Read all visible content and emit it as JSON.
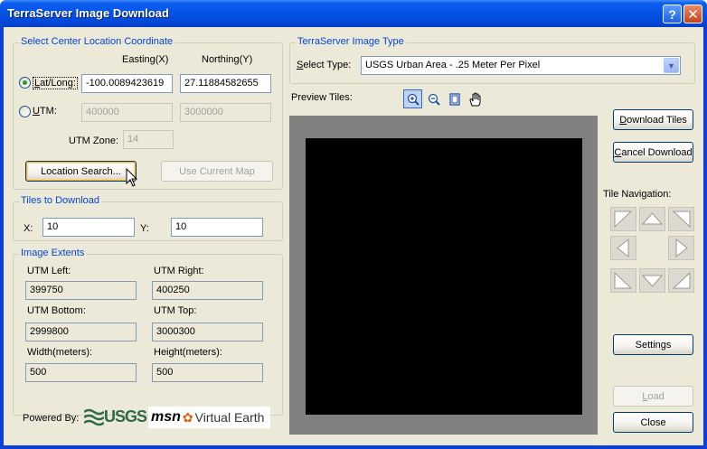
{
  "window": {
    "title": "TerraServer Image Download",
    "help_glyph": "?",
    "close_glyph": "✕"
  },
  "center": {
    "group_title": "Select Center Location Coordinate",
    "easting_header": "Easting(X)",
    "northing_header": "Northing(Y)",
    "latlong_label": "Lat/Long:",
    "latlong_selected": true,
    "latlong_easting": "-100.0089423619",
    "latlong_northing": "27.11884582655",
    "utm_label": "UTM:",
    "utm_easting": "400000",
    "utm_northing": "3000000",
    "utm_zone_label": "UTM Zone:",
    "utm_zone": "14",
    "location_search_label": "Location Search...",
    "use_current_map_label": "Use Current Map"
  },
  "tiles": {
    "group_title": "Tiles to Download",
    "x_label": "X:",
    "x_value": "10",
    "y_label": "Y:",
    "y_value": "10"
  },
  "extents": {
    "group_title": "Image Extents",
    "utm_left_label": "UTM Left:",
    "utm_left": "399750",
    "utm_right_label": "UTM Right:",
    "utm_right": "400250",
    "utm_bottom_label": "UTM Bottom:",
    "utm_bottom": "2999800",
    "utm_top_label": "UTM Top:",
    "utm_top": "3000300",
    "width_label": "Width(meters):",
    "width": "500",
    "height_label": "Height(meters):",
    "height": "500"
  },
  "footer": {
    "powered_by": "Powered By:",
    "usgs_logo": "USGS",
    "msn_logo": "msn",
    "virtual_earth_logo": "Virtual Earth"
  },
  "image_type": {
    "group_title": "TerraServer Image Type",
    "select_label": "Select Type:",
    "selected": "USGS Urban Area - .25 Meter Per Pixel"
  },
  "preview": {
    "label": "Preview Tiles:",
    "tools": [
      "zoom-in-icon",
      "zoom-out-icon",
      "page-icon",
      "pan-hand-icon"
    ]
  },
  "actions": {
    "download_tiles": "Download Tiles",
    "cancel_download": "Cancel Download",
    "tile_navigation": "Tile Navigation:",
    "settings": "Settings",
    "load": "Load",
    "close": "Close"
  },
  "colors": {
    "titlebar": "#0553e3",
    "dialog_bg": "#ece9d8",
    "group_title": "#0046d5",
    "usgs_green": "#2e6b45"
  }
}
